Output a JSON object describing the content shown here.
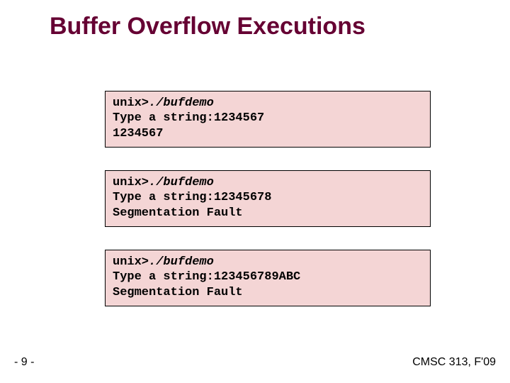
{
  "title": "Buffer Overflow Executions",
  "boxes": [
    {
      "prompt": "unix>",
      "cmd": "./bufdemo",
      "echo_label": "Type a string:",
      "input": "1234567",
      "output": "1234567"
    },
    {
      "prompt": "unix>",
      "cmd": "./bufdemo",
      "echo_label": "Type a string:",
      "input": "12345678",
      "output": "Segmentation Fault"
    },
    {
      "prompt": "unix>",
      "cmd": "./bufdemo",
      "echo_label": "Type a string:",
      "input": "123456789ABC",
      "output": "Segmentation Fault"
    }
  ],
  "page_number": "- 9 -",
  "footer": "CMSC 313, F'09"
}
